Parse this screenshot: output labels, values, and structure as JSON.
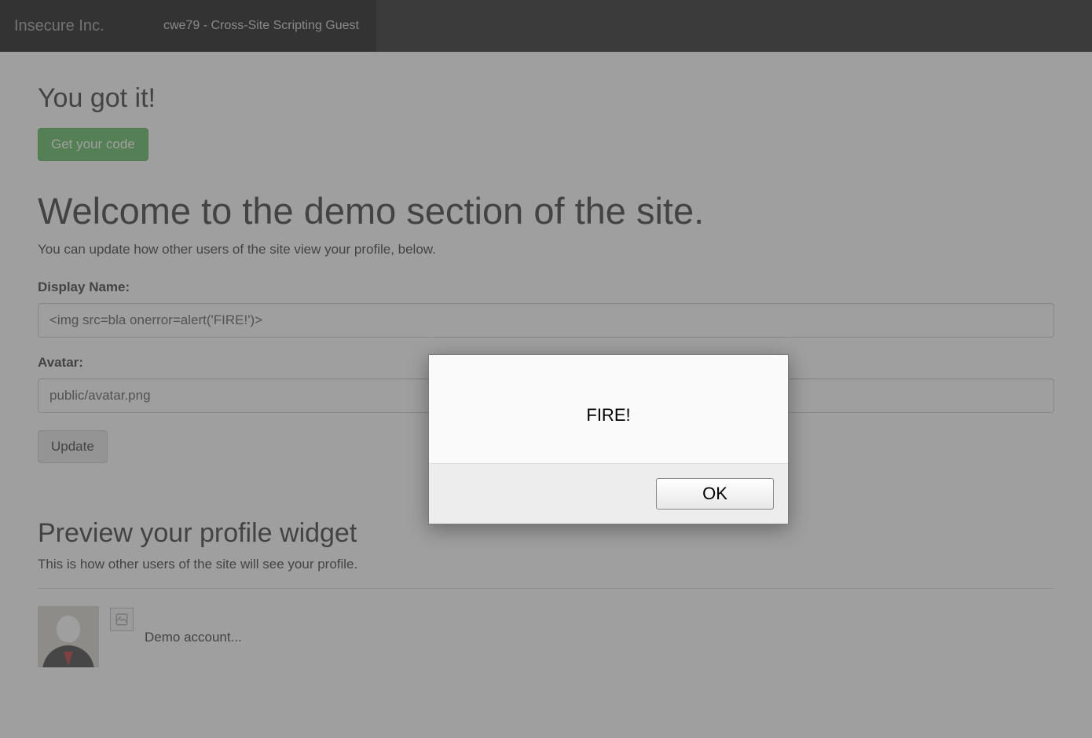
{
  "navbar": {
    "brand": "Insecure Inc.",
    "item": "cwe79 - Cross-Site Scripting Guest"
  },
  "success": {
    "heading": "You got it!",
    "button": "Get your code"
  },
  "welcome": {
    "heading": "Welcome to the demo section of the site.",
    "subtext": "You can update how other users of the site view your profile, below."
  },
  "form": {
    "display_name_label": "Display Name:",
    "display_name_value": "<img src=bla onerror=alert('FIRE!')>",
    "avatar_label": "Avatar:",
    "avatar_value": "public/avatar.png",
    "submit": "Update"
  },
  "preview": {
    "heading": "Preview your profile widget",
    "subtext": "This is how other users of the site will see your profile.",
    "account_label": "Demo account..."
  },
  "dialog": {
    "message": "FIRE!",
    "ok": "OK"
  }
}
